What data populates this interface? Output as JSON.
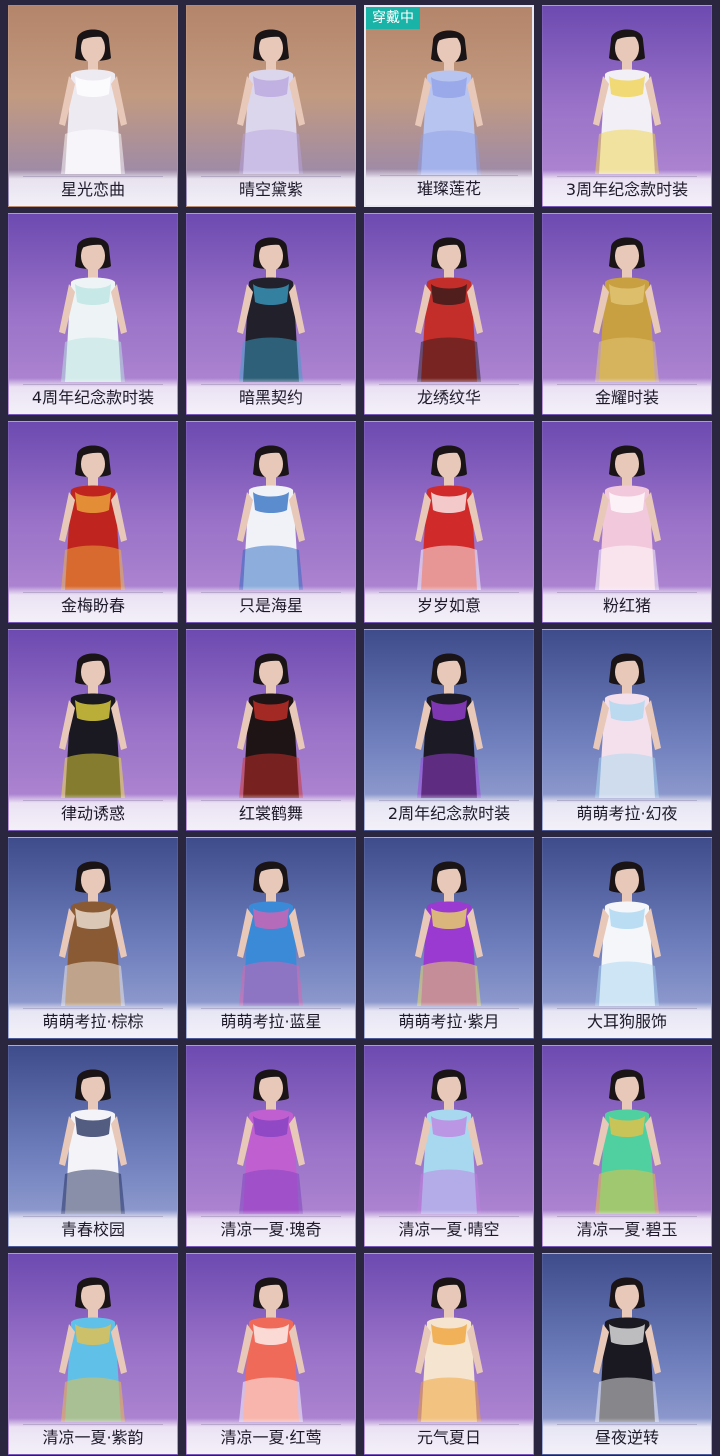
{
  "status_badge": "穿戴中",
  "outfits": [
    {
      "name": "星光恋曲",
      "bg": "warm",
      "color": "#eeeaf2",
      "accent": "#ffffff"
    },
    {
      "name": "晴空黛紫",
      "bg": "warm",
      "color": "#dcd6ec",
      "accent": "#b8a4e0"
    },
    {
      "name": "璀璨莲花",
      "bg": "warm",
      "color": "#b8c4f0",
      "accent": "#8fa0e8",
      "selected": true
    },
    {
      "name": "3周年纪念款时装",
      "bg": "purple",
      "color": "#f2f0f6",
      "accent": "#f0d34a"
    },
    {
      "name": "4周年纪念款时装",
      "bg": "purple",
      "color": "#eef4f6",
      "accent": "#b8e4e0"
    },
    {
      "name": "暗黑契约",
      "bg": "purple",
      "color": "#22202a",
      "accent": "#3aa0c8"
    },
    {
      "name": "龙绣纹华",
      "bg": "purple",
      "color": "#c42e2a",
      "accent": "#2a1a1a"
    },
    {
      "name": "金耀时装",
      "bg": "purple",
      "color": "#c8a042",
      "accent": "#e4c87a"
    },
    {
      "name": "金梅盼春",
      "bg": "purple",
      "color": "#c0241e",
      "accent": "#f0b040"
    },
    {
      "name": "只是海星",
      "bg": "purple",
      "color": "#f0f2f8",
      "accent": "#2a6ac0"
    },
    {
      "name": "岁岁如意",
      "bg": "purple",
      "color": "#d02a2a",
      "accent": "#ffffff"
    },
    {
      "name": "粉红猪",
      "bg": "purple",
      "color": "#f2c8dc",
      "accent": "#ffffff"
    },
    {
      "name": "律动诱惑",
      "bg": "purple",
      "color": "#1a1820",
      "accent": "#f0e040"
    },
    {
      "name": "红裳鹤舞",
      "bg": "purple",
      "color": "#1e1416",
      "accent": "#d0302a"
    },
    {
      "name": "2周年纪念款时装",
      "bg": "blue",
      "color": "#1c1a24",
      "accent": "#a040e0"
    },
    {
      "name": "萌萌考拉·幻夜",
      "bg": "blue",
      "color": "#f4e0ec",
      "accent": "#a8d8f0"
    },
    {
      "name": "萌萌考拉·棕棕",
      "bg": "blue",
      "color": "#8a5a34",
      "accent": "#f4ece0"
    },
    {
      "name": "萌萌考拉·蓝星",
      "bg": "blue",
      "color": "#3a8ad8",
      "accent": "#e060b0"
    },
    {
      "name": "萌萌考拉·紫月",
      "bg": "blue",
      "color": "#9a3ad0",
      "accent": "#f0e060"
    },
    {
      "name": "大耳狗服饰",
      "bg": "blue",
      "color": "#f4f6fa",
      "accent": "#a8d4f0"
    },
    {
      "name": "青春校园",
      "bg": "blue",
      "color": "#f4f4f8",
      "accent": "#1e2a5a"
    },
    {
      "name": "清凉一夏·瑰奇",
      "bg": "purple",
      "color": "#c060d0",
      "accent": "#8040c0"
    },
    {
      "name": "清凉一夏·晴空",
      "bg": "purple",
      "color": "#a8d8f0",
      "accent": "#c080e0"
    },
    {
      "name": "清凉一夏·碧玉",
      "bg": "purple",
      "color": "#50d0a0",
      "accent": "#f0c040"
    },
    {
      "name": "清凉一夏·紫韵",
      "bg": "purple",
      "color": "#60c0e8",
      "accent": "#f0c040"
    },
    {
      "name": "清凉一夏·红莺",
      "bg": "purple",
      "color": "#f06a5a",
      "accent": "#ffffff"
    },
    {
      "name": "元气夏日",
      "bg": "purple",
      "color": "#f4e4d0",
      "accent": "#f0a030"
    },
    {
      "name": "昼夜逆转",
      "bg": "blue",
      "color": "#1a1820",
      "accent": "#f4f4f6"
    }
  ]
}
